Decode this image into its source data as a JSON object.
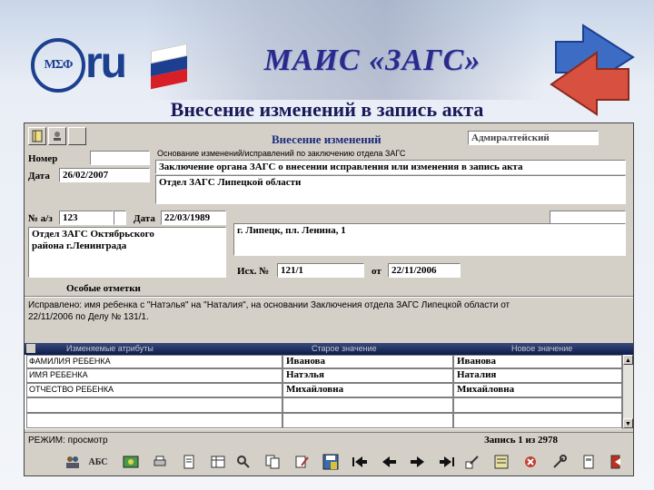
{
  "slide": {
    "logo_text": "ru",
    "logo_mark": "MΣΦ",
    "title": "МАИС «ЗАГС»",
    "subtitle": "Внесение изменений в запись акта"
  },
  "window": {
    "header_title": "Внесение изменений",
    "district": "Адмиралтейский",
    "nomer_label": "Номер",
    "nomer_value": "",
    "data_label": "Дата",
    "data_value": "26/02/2007",
    "basis_label": "Основание изменений/исправлений по заключению отдела ЗАГС",
    "basis_line1": "Заключение органа ЗАГС о внесении исправления или изменения в запись акта",
    "basis_line2": "Отдел ЗАГС Липецкой области",
    "act_no_label": "№ а/з",
    "act_no_value": "123",
    "act_date_label": "Дата",
    "act_date_value": "22/03/1989",
    "org_line1": "Отдел ЗАГС Октябрьского",
    "org_line2": "района г.Ленинграда",
    "address": "г. Липецк, пл. Ленина, 1",
    "outgoing_label": "Исх. №",
    "outgoing_value": "121/1",
    "from_label": "от",
    "from_value": "22/11/2006",
    "special_marks_label": "Особые отметки",
    "special_marks_text_1": "Исправлено: имя ребенка с \"Натэлья\" на \"Наталия\", на основании Заключения отдела ЗАГС Липецкой области от",
    "special_marks_text_2": "22/11/2006 по Делу № 131/1."
  },
  "grid": {
    "columns": [
      "Изменяемые атрибуты",
      "Старое значение",
      "Новое значение"
    ],
    "rows": [
      [
        "ФАМИЛИЯ РЕБЕНКА",
        "Иванова",
        "Иванова"
      ],
      [
        "ИМЯ РЕБЕНКА",
        "Натэлья",
        "Наталия"
      ],
      [
        "ОТЧЕСТВО РЕБЕНКА",
        "Михайловна",
        "Михайловна"
      ]
    ]
  },
  "status": {
    "mode": "РЕЖИМ: просмотр",
    "record": "Запись 1 из 2978"
  },
  "toolbar": {
    "abc_label": "АБС"
  },
  "colors": {
    "title": "#2a2a8a",
    "window_bg": "#d4d0c8",
    "grid_header": "#0a1a4a",
    "logo_blue": "#1c3f8f",
    "flag_red": "#d81e26"
  }
}
